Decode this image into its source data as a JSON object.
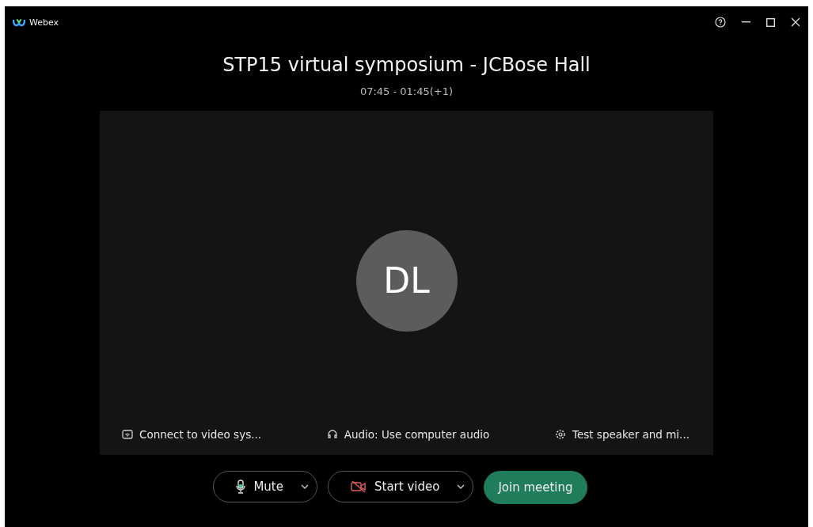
{
  "window": {
    "app_name": "Webex"
  },
  "meeting": {
    "title": "STP15 virtual symposium - JCBose Hall",
    "time": "07:45 - 01:45(+1)"
  },
  "preview": {
    "avatar_initials": "DL"
  },
  "options": [
    {
      "kind": "video-system",
      "label": "Connect to video sys..."
    },
    {
      "kind": "audio",
      "label": "Audio: Use computer audio"
    },
    {
      "kind": "settings",
      "label": "Test speaker and mi..."
    }
  ],
  "controls": [
    {
      "kind": "mute",
      "label": "Mute",
      "off": false
    },
    {
      "kind": "video",
      "label": "Start video",
      "off": true
    },
    {
      "kind": "join",
      "label": "Join meeting"
    }
  ]
}
